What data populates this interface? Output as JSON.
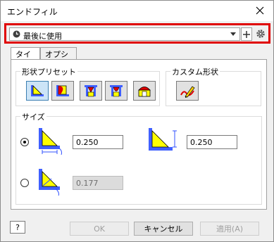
{
  "window": {
    "title": "エンドフィル"
  },
  "preset": {
    "value": "最後に使用"
  },
  "tabs": [
    {
      "label": "タイプ",
      "active": true
    },
    {
      "label": "オプション",
      "active": false
    }
  ],
  "shape_presets": {
    "label": "形状プリセット"
  },
  "custom_shape": {
    "label": "カスタム形状"
  },
  "size": {
    "label": "サイズ",
    "option1": {
      "value1": "0.250",
      "value2": "0.250",
      "selected": true
    },
    "option2": {
      "value": "0.177",
      "selected": false
    }
  },
  "buttons": {
    "help": "?",
    "ok": "OK",
    "cancel": "キャンセル",
    "apply": "適用(A)"
  },
  "colors": {
    "highlight": "#e00000",
    "shape_yellow": "#ffff00",
    "shape_blue": "#4060ff",
    "shape_red": "#e00000"
  }
}
